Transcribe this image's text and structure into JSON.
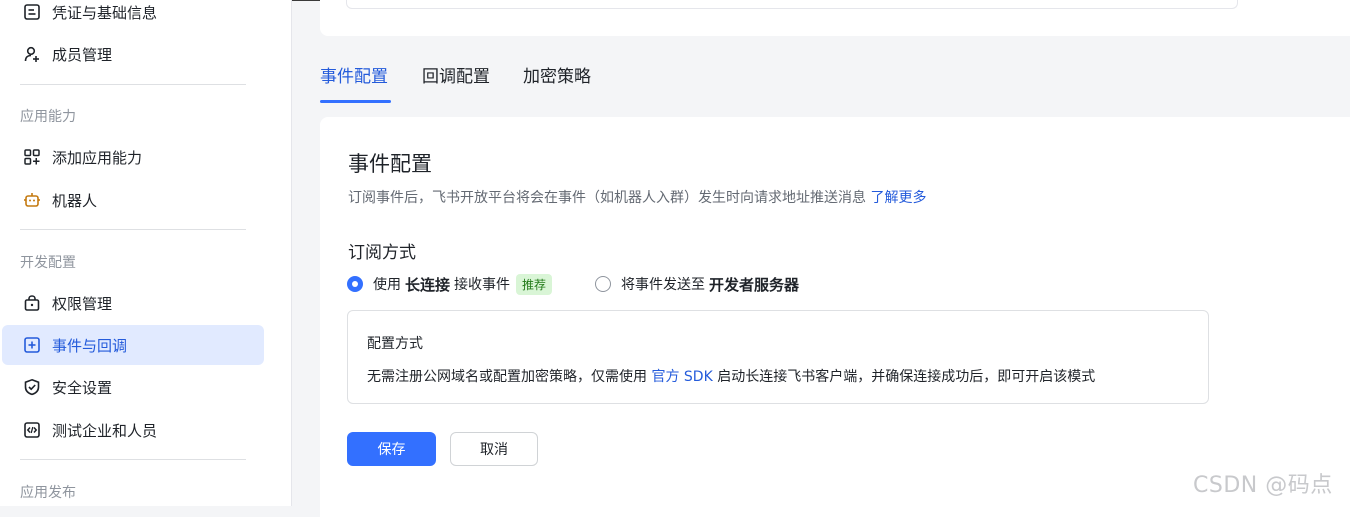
{
  "sidebar": {
    "items": [
      {
        "label": "凭证与基础信息"
      },
      {
        "label": "成员管理"
      },
      {
        "label": "添加应用能力"
      },
      {
        "label": "机器人"
      },
      {
        "label": "权限管理"
      },
      {
        "label": "事件与回调"
      },
      {
        "label": "安全设置"
      },
      {
        "label": "测试企业和人员"
      }
    ],
    "sections": [
      "应用能力",
      "开发配置",
      "应用发布"
    ],
    "active_color": "#245bdb"
  },
  "tabs": [
    {
      "label": "事件配置"
    },
    {
      "label": "回调配置"
    },
    {
      "label": "加密策略"
    }
  ],
  "main": {
    "title": "事件配置",
    "desc": "订阅事件后，飞书开放平台将会在事件（如机器人入群）发生时向请求地址推送消息",
    "desc_link": "了解更多",
    "sub_title": "订阅方式",
    "option1": {
      "pre": "使用",
      "bold": "长连接",
      "post": "接收事件",
      "tag": "推荐"
    },
    "option2": {
      "pre": "将事件发送至",
      "bold": "开发者服务器"
    },
    "info": {
      "title": "配置方式",
      "text_pre": "无需注册公网域名或配置加密策略，仅需使用",
      "link": "官方 SDK",
      "text_post": "启动长连接飞书客户端，并确保连接成功后，即可开启该模式"
    },
    "save_label": "保存",
    "cancel_label": "取消"
  },
  "watermark": "CSDN @码点",
  "icons": [
    "id-card-icon",
    "user-add-icon",
    "apps-add-icon",
    "robot-icon",
    "lock-icon",
    "event-icon",
    "shield-icon",
    "code-icon"
  ],
  "colors": {
    "primary": "#3370ff",
    "link": "#245bdb",
    "tag_bg": "#d9f5d6",
    "tag_text": "#237b19"
  }
}
